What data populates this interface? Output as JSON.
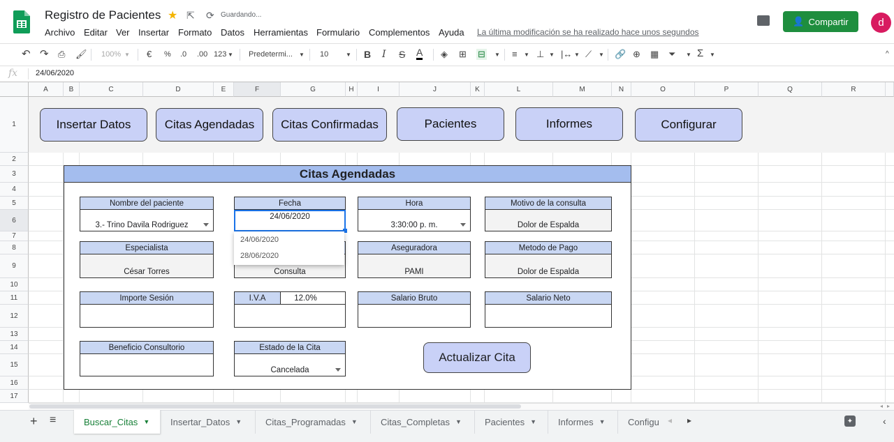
{
  "header": {
    "doc_title": "Registro de Pacientes",
    "saving_status": "Guardando...",
    "last_modified": "La última modificación se ha realizado hace unos segundos",
    "share_label": "Compartir",
    "avatar_letter": "d",
    "menu": [
      "Archivo",
      "Editar",
      "Ver",
      "Insertar",
      "Formato",
      "Datos",
      "Herramientas",
      "Formulario",
      "Complementos",
      "Ayuda"
    ]
  },
  "toolbar": {
    "zoom": "100%",
    "currency": "€",
    "percent": "%",
    "dec_less": ".0",
    "dec_more": ".00",
    "more_formats": "123",
    "font": "Predetermi...",
    "font_size": "10",
    "bold": "B",
    "italic": "I",
    "strike": "S",
    "text_color": "A"
  },
  "formula_bar": {
    "fx": "fx",
    "value": "24/06/2020"
  },
  "columns": [
    "A",
    "B",
    "C",
    "D",
    "E",
    "F",
    "G",
    "H",
    "I",
    "J",
    "K",
    "L",
    "M",
    "N",
    "O",
    "P",
    "Q",
    "R"
  ],
  "rows": [
    "1",
    "2",
    "3",
    "4",
    "5",
    "6",
    "7",
    "8",
    "9",
    "10",
    "11",
    "12",
    "13",
    "14",
    "15",
    "16",
    "17"
  ],
  "nav_buttons": [
    "Insertar Datos",
    "Citas Agendadas",
    "Citas Confirmadas",
    "Pacientes",
    "Informes",
    "Configurar"
  ],
  "panel": {
    "title": "Citas Agendadas",
    "fields": {
      "nombre": {
        "label": "Nombre del paciente",
        "value": "3.- Trino Davila Rodriguez"
      },
      "fecha": {
        "label": "Fecha",
        "value": "24/06/2020"
      },
      "hora": {
        "label": "Hora",
        "value": "3:30:00 p. m."
      },
      "motivo": {
        "label": "Motivo de la consulta",
        "value": "Dolor de Espalda"
      },
      "especialista": {
        "label": "Especialista",
        "value": "César Torres"
      },
      "tipo": {
        "value": "Consulta"
      },
      "aseguradora": {
        "label": "Aseguradora",
        "value": "PAMI"
      },
      "pago": {
        "label": "Metodo de Pago",
        "value": "Dolor de Espalda"
      },
      "importe": {
        "label": "Importe Sesión",
        "value": ""
      },
      "iva": {
        "label": "I.V.A",
        "value": "12.0%"
      },
      "salario_bruto": {
        "label": "Salario Bruto",
        "value": ""
      },
      "salario_neto": {
        "label": "Salario Neto",
        "value": ""
      },
      "beneficio": {
        "label": "Beneficio Consultorio",
        "value": ""
      },
      "estado": {
        "label": "Estado de la Cita",
        "value": "Cancelada"
      }
    },
    "date_options": [
      "24/06/2020",
      "28/06/2020"
    ],
    "update_button": "Actualizar Cita"
  },
  "sheets": [
    {
      "name": "Buscar_Citas",
      "active": true
    },
    {
      "name": "Insertar_Datos",
      "active": false
    },
    {
      "name": "Citas_Programadas",
      "active": false
    },
    {
      "name": "Citas_Completas",
      "active": false
    },
    {
      "name": "Pacientes",
      "active": false
    },
    {
      "name": "Informes",
      "active": false
    },
    {
      "name": "Configu",
      "active": false
    }
  ],
  "colors": {
    "accent": "#1e8e3e",
    "button_fill": "#c9d1f7",
    "title_fill": "#a4bdee",
    "label_fill": "#c9d7f3"
  }
}
